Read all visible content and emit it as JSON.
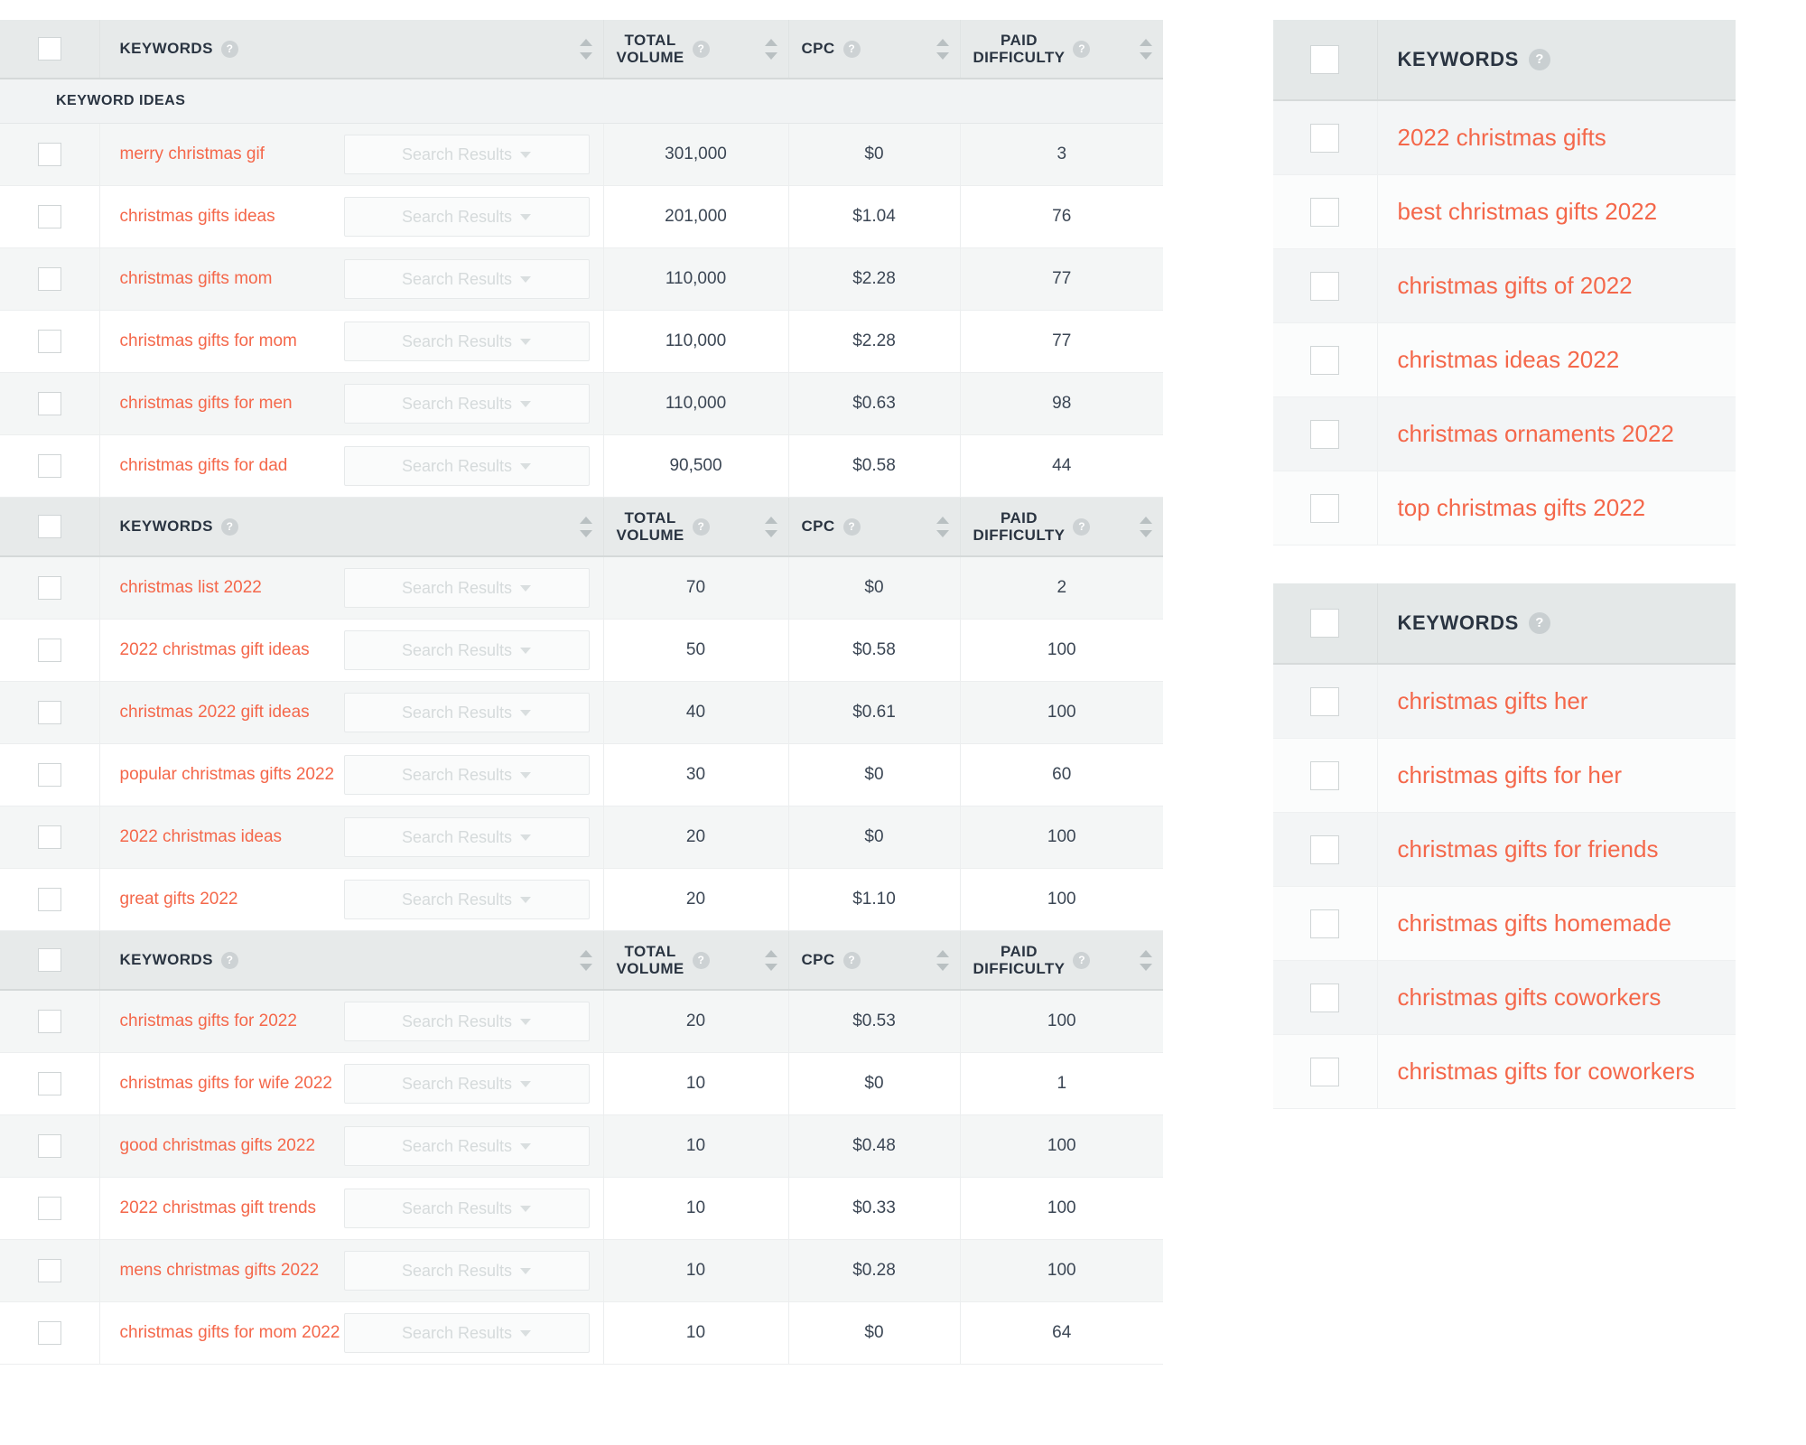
{
  "theme": {
    "link_color": "#f4674a",
    "header_bg": "#e7eaea",
    "row_alt_bg": "#f4f6f6",
    "text_color": "#2a3441"
  },
  "left_panel": {
    "columns": {
      "keywords": "KEYWORDS",
      "total_volume": "TOTAL\nVOLUME",
      "cpc": "CPC",
      "paid_difficulty": "PAID\nDIFFICULTY"
    },
    "help_glyph": "?",
    "search_results_label": "Search Results",
    "sections": [
      {
        "banner": "KEYWORD IDEAS",
        "has_banner": true,
        "rows": [
          {
            "keyword": "merry christmas gif",
            "total_volume": "301,000",
            "cpc": "$0",
            "paid_difficulty": "3"
          },
          {
            "keyword": "christmas gifts ideas",
            "total_volume": "201,000",
            "cpc": "$1.04",
            "paid_difficulty": "76"
          },
          {
            "keyword": "christmas gifts mom",
            "total_volume": "110,000",
            "cpc": "$2.28",
            "paid_difficulty": "77"
          },
          {
            "keyword": "christmas gifts for mom",
            "total_volume": "110,000",
            "cpc": "$2.28",
            "paid_difficulty": "77"
          },
          {
            "keyword": "christmas gifts for men",
            "total_volume": "110,000",
            "cpc": "$0.63",
            "paid_difficulty": "98"
          },
          {
            "keyword": "christmas gifts for dad",
            "total_volume": "90,500",
            "cpc": "$0.58",
            "paid_difficulty": "44"
          }
        ]
      },
      {
        "banner": "",
        "has_banner": false,
        "rows": [
          {
            "keyword": "christmas list 2022",
            "total_volume": "70",
            "cpc": "$0",
            "paid_difficulty": "2"
          },
          {
            "keyword": "2022 christmas gift ideas",
            "total_volume": "50",
            "cpc": "$0.58",
            "paid_difficulty": "100"
          },
          {
            "keyword": "christmas 2022 gift ideas",
            "total_volume": "40",
            "cpc": "$0.61",
            "paid_difficulty": "100"
          },
          {
            "keyword": "popular christmas gifts 2022",
            "total_volume": "30",
            "cpc": "$0",
            "paid_difficulty": "60"
          },
          {
            "keyword": "2022 christmas ideas",
            "total_volume": "20",
            "cpc": "$0",
            "paid_difficulty": "100"
          },
          {
            "keyword": "great gifts 2022",
            "total_volume": "20",
            "cpc": "$1.10",
            "paid_difficulty": "100"
          }
        ]
      },
      {
        "banner": "",
        "has_banner": false,
        "rows": [
          {
            "keyword": "christmas gifts for 2022",
            "total_volume": "20",
            "cpc": "$0.53",
            "paid_difficulty": "100"
          },
          {
            "keyword": "christmas gifts for wife 2022",
            "total_volume": "10",
            "cpc": "$0",
            "paid_difficulty": "1"
          },
          {
            "keyword": "good christmas gifts 2022",
            "total_volume": "10",
            "cpc": "$0.48",
            "paid_difficulty": "100"
          },
          {
            "keyword": "2022 christmas gift trends",
            "total_volume": "10",
            "cpc": "$0.33",
            "paid_difficulty": "100"
          },
          {
            "keyword": "mens christmas gifts 2022",
            "total_volume": "10",
            "cpc": "$0.28",
            "paid_difficulty": "100"
          },
          {
            "keyword": "christmas gifts for mom 2022",
            "total_volume": "10",
            "cpc": "$0",
            "paid_difficulty": "64"
          }
        ]
      }
    ]
  },
  "right_panel": {
    "help_glyph": "?",
    "tables": [
      {
        "header": "KEYWORDS",
        "rows": [
          {
            "keyword": "2022 christmas gifts"
          },
          {
            "keyword": "best christmas gifts 2022"
          },
          {
            "keyword": "christmas gifts of 2022"
          },
          {
            "keyword": "christmas ideas 2022"
          },
          {
            "keyword": "christmas ornaments 2022"
          },
          {
            "keyword": "top christmas gifts 2022"
          }
        ]
      },
      {
        "header": "KEYWORDS",
        "rows": [
          {
            "keyword": "christmas gifts her"
          },
          {
            "keyword": "christmas gifts for her"
          },
          {
            "keyword": "christmas gifts for friends"
          },
          {
            "keyword": "christmas gifts homemade"
          },
          {
            "keyword": "christmas gifts coworkers"
          },
          {
            "keyword": "christmas gifts for coworkers"
          }
        ]
      }
    ]
  }
}
